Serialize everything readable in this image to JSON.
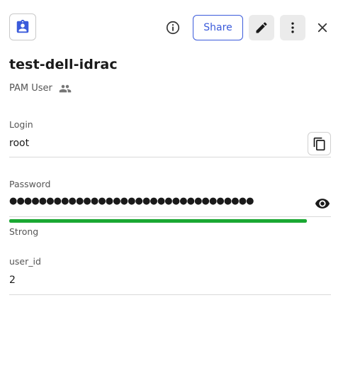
{
  "header": {
    "record_icon": "clipboard-account-icon",
    "info_icon": "info-icon",
    "share_label": "Share",
    "edit_icon": "pencil-icon",
    "more_icon": "more-vertical-icon",
    "close_icon": "close-icon"
  },
  "record": {
    "title": "test-dell-idrac",
    "type": "PAM User",
    "type_icon": "people-icon"
  },
  "fields": {
    "login": {
      "label": "Login",
      "value": "root",
      "copy_icon": "copy-icon"
    },
    "password": {
      "label": "Password",
      "masked": "●●●●●●●●●●●●●●●●●●●●●●●●●●●●●●●●●",
      "strength": "Strong",
      "strength_fraction": 1.0,
      "strength_color": "#1aa832",
      "reveal_icon": "eye-icon"
    },
    "user_id": {
      "label": "user_id",
      "value": "2"
    }
  },
  "colors": {
    "accent": "#3b5bdb",
    "icon_button_bg": "#ebebeb"
  }
}
